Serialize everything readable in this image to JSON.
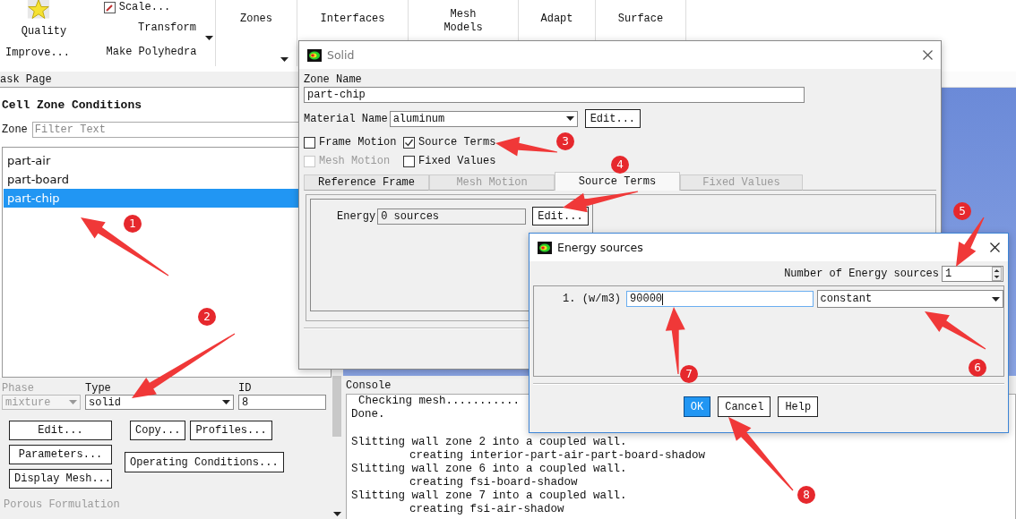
{
  "ribbon": {
    "quality": "Quality",
    "improve": "Improve...",
    "scale": "Scale...",
    "transform": "Transform",
    "make_polyhedra": "Make Polyhedra",
    "menus": [
      "Zones",
      "Interfaces",
      "Mesh Models",
      "Adapt",
      "Surface"
    ]
  },
  "task_page": {
    "header": "ask Page",
    "title": "Cell Zone Conditions",
    "zone_label": "Zone",
    "filter": {
      "placeholder": "Filter Text"
    },
    "zones": [
      {
        "label": "part-air",
        "selected": false
      },
      {
        "label": "part-board",
        "selected": false
      },
      {
        "label": "part-chip",
        "selected": true
      }
    ],
    "phase": {
      "label": "Phase",
      "value": "mixture",
      "disabled": true
    },
    "type": {
      "label": "Type",
      "value": "solid"
    },
    "id": {
      "label": "ID",
      "value": "8"
    },
    "buttons_left": [
      "Edit...",
      "Parameters...",
      "Display Mesh..."
    ],
    "buttons_right": [
      "Copy...",
      "Profiles..."
    ],
    "operating_button": "Operating Conditions...",
    "porous_heading": "Porous Formulation"
  },
  "console": {
    "title": "Console",
    "blocks": [
      [
        {
          "text": "Checking mesh...........",
          "indent": false
        },
        {
          "text": "Done.",
          "indent": false
        }
      ],
      [
        {
          "text": "Slitting wall zone 2 into a coupled wall.",
          "indent": false
        },
        {
          "text": "creating interior-part-air-part-board-shadow",
          "indent": true
        },
        {
          "text": "Slitting wall zone 6 into a coupled wall.",
          "indent": false
        },
        {
          "text": "creating fsi-board-shadow",
          "indent": true
        },
        {
          "text": "Slitting wall zone 7 into a coupled wall.",
          "indent": false
        },
        {
          "text": "creating fsi-air-shadow",
          "indent": true
        }
      ]
    ]
  },
  "solid_dialog": {
    "title": "Solid",
    "zone_name_label": "Zone Name",
    "zone_name": "part-chip",
    "material_label": "Material Name",
    "material": "aluminum",
    "edit_button": "Edit...",
    "options": [
      {
        "label": "Frame Motion",
        "checked": false,
        "disabled": false
      },
      {
        "label": "Source Terms",
        "checked": true,
        "disabled": false
      },
      {
        "label": "Mesh Motion",
        "checked": false,
        "disabled": true
      },
      {
        "label": "Fixed Values",
        "checked": false,
        "disabled": false
      }
    ],
    "tabs": [
      {
        "label": "Reference Frame",
        "selected": false,
        "disabled": false
      },
      {
        "label": "Mesh Motion",
        "selected": false,
        "disabled": true
      },
      {
        "label": "Source Terms",
        "selected": true,
        "disabled": false
      },
      {
        "label": "Fixed Values",
        "selected": false,
        "disabled": true
      }
    ],
    "energy_label": "Energy",
    "energy_value": "0 sources",
    "energy_edit_button": "Edit..."
  },
  "energy_dialog": {
    "title": "Energy sources",
    "count_label": "Number of Energy sources",
    "count": "1",
    "sources": [
      {
        "index": "1.",
        "unit": "(w/m3)",
        "value": "90000",
        "method": "constant"
      }
    ],
    "buttons": [
      {
        "label": "OK",
        "primary": true
      },
      {
        "label": "Cancel",
        "primary": false
      },
      {
        "label": "Help",
        "primary": false
      }
    ]
  },
  "annotations": [
    "1",
    "2",
    "3",
    "4",
    "5",
    "6",
    "7",
    "8"
  ]
}
